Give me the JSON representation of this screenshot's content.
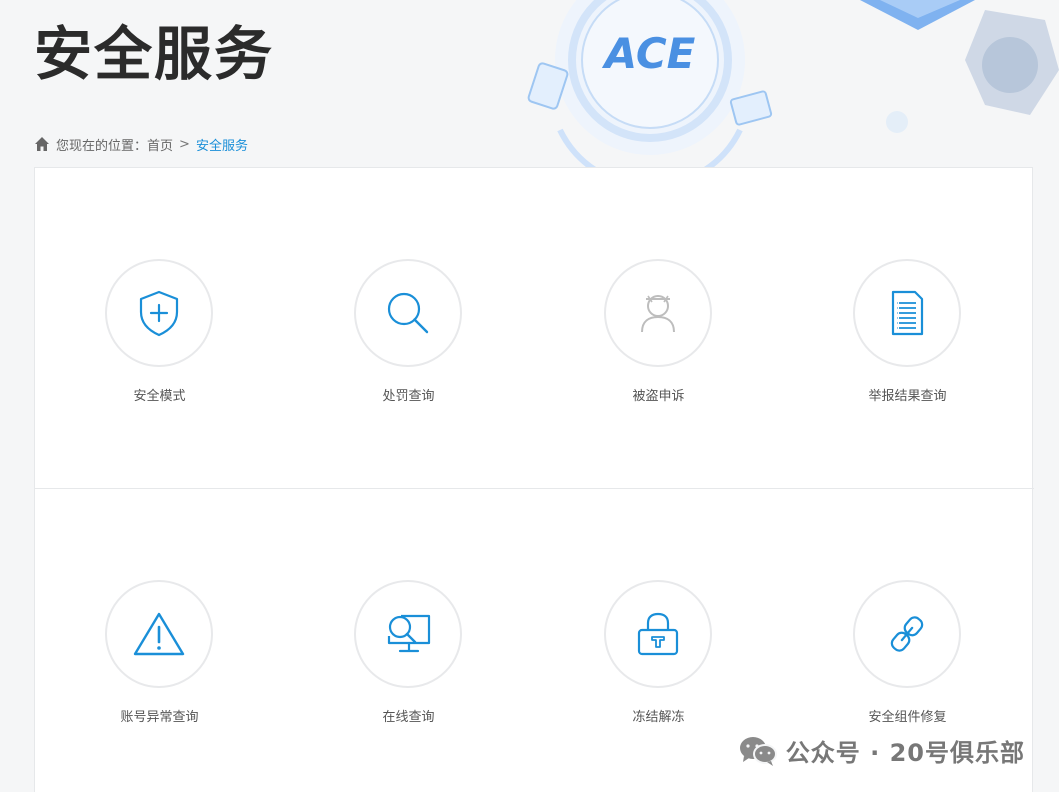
{
  "header": {
    "title": "安全服务",
    "logo_text": "ACE"
  },
  "breadcrumb": {
    "prefix": "您现在的位置：",
    "home": "首页",
    "separator": ">",
    "current": "安全服务"
  },
  "services": [
    {
      "label": "安全模式",
      "icon": "shield-plus-icon"
    },
    {
      "label": "处罚查询",
      "icon": "magnifier-icon"
    },
    {
      "label": "被盗申诉",
      "icon": "masked-user-icon"
    },
    {
      "label": "举报结果查询",
      "icon": "document-list-icon"
    },
    {
      "label": "账号异常查询",
      "icon": "warning-triangle-icon"
    },
    {
      "label": "在线查询",
      "icon": "monitor-search-icon"
    },
    {
      "label": "冻结解冻",
      "icon": "padlock-icon"
    },
    {
      "label": "安全组件修复",
      "icon": "chain-link-icon"
    }
  ],
  "watermark": {
    "text": "公众号 · 20号俱乐部"
  },
  "colors": {
    "accent": "#1a8fd8",
    "icon_gray": "#bdbdbd"
  }
}
